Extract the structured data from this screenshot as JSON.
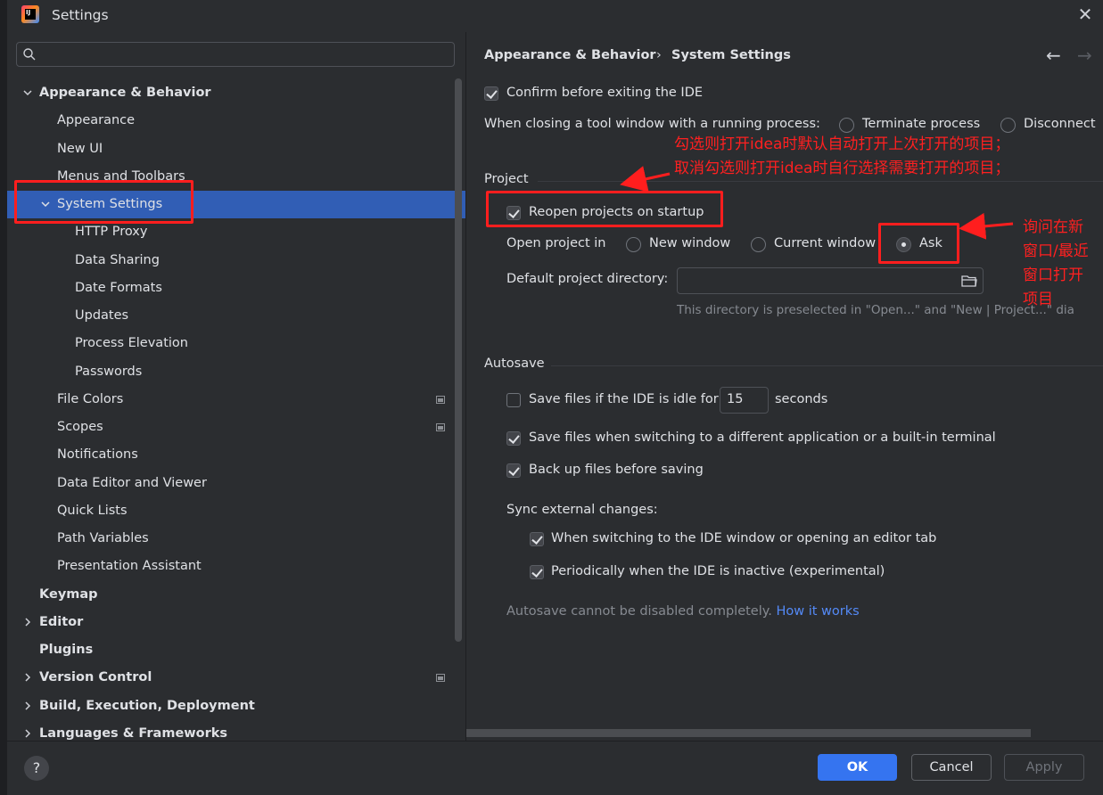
{
  "window": {
    "title": "Settings"
  },
  "search": {
    "placeholder": ""
  },
  "tree": {
    "appearance_behavior": "Appearance & Behavior",
    "appearance": "Appearance",
    "new_ui": "New UI",
    "menus_toolbars": "Menus and Toolbars",
    "system_settings": "System Settings",
    "http_proxy": "HTTP Proxy",
    "data_sharing": "Data Sharing",
    "date_formats": "Date Formats",
    "updates": "Updates",
    "process_elevation": "Process Elevation",
    "passwords": "Passwords",
    "file_colors": "File Colors",
    "scopes": "Scopes",
    "notifications": "Notifications",
    "data_editor": "Data Editor and Viewer",
    "quick_lists": "Quick Lists",
    "path_variables": "Path Variables",
    "presentation_assistant": "Presentation Assistant",
    "keymap": "Keymap",
    "editor": "Editor",
    "plugins": "Plugins",
    "version_control": "Version Control",
    "build": "Build, Execution, Deployment",
    "languages": "Languages & Frameworks"
  },
  "breadcrumb": {
    "parent": "Appearance & Behavior",
    "separator": "›",
    "current": "System Settings",
    "back": "←",
    "forward": "→"
  },
  "general": {
    "confirm_exit": "Confirm before exiting the IDE",
    "closing_tool_window": "When closing a tool window with a running process:",
    "terminate": "Terminate process",
    "disconnect": "Disconnect"
  },
  "project": {
    "section": "Project",
    "reopen": "Reopen projects on startup",
    "open_in": "Open project in",
    "new_window": "New window",
    "current_window": "Current window",
    "ask": "Ask",
    "default_dir_label": "Default project directory:",
    "default_dir_value": "",
    "dir_hint": "This directory is preselected in \"Open...\" and \"New | Project...\" dia"
  },
  "autosave": {
    "section": "Autosave",
    "idle_label": "Save files if the IDE is idle for",
    "idle_value": "15",
    "seconds": "seconds",
    "switching": "Save files when switching to a different application or a built-in terminal",
    "backup": "Back up files before saving",
    "sync_label": "Sync external changes:",
    "sync_switching": "When switching to the IDE window or opening an editor tab",
    "sync_periodic": "Periodically when the IDE is inactive (experimental)",
    "note": "Autosave cannot be disabled completely.",
    "how_it_works": "How it works"
  },
  "annotations": {
    "line1": "勾选则打开idea时默认自动打开上次打开的项目；",
    "line2": "取消勾选则打开idea时自行选择需要打开的项目；",
    "ask1": "询问在新",
    "ask2": "窗口/最近",
    "ask3": "窗口打开",
    "ask4": "项目"
  },
  "buttons": {
    "ok": "OK",
    "cancel": "Cancel",
    "apply": "Apply",
    "help": "?"
  },
  "colors": {
    "accent": "#3574f0",
    "annotation": "#ff1e1e",
    "background": "#2b2d30"
  }
}
